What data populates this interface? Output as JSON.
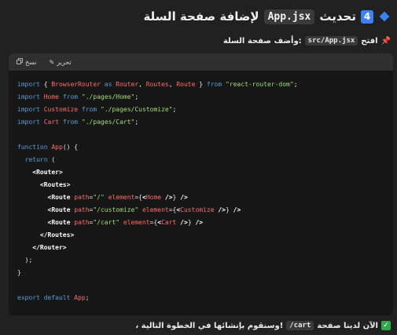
{
  "heading": {
    "badge": "4",
    "word_update": "تحديث",
    "file_code": "App.jsx",
    "rest": "لإضافة صفحة السلة"
  },
  "instruction": {
    "word_open": "افتح",
    "file_code": "src/App.jsx",
    "rest": "وأضف صفحة السلة:"
  },
  "code_header": {
    "copy_label": "نسخ",
    "edit_label": "تحرير"
  },
  "code_lines": [
    [
      [
        "kw",
        "import"
      ],
      [
        "plain",
        " { "
      ],
      [
        "ident",
        "BrowserRouter"
      ],
      [
        "kw",
        " as "
      ],
      [
        "ident",
        "Router"
      ],
      [
        "plain",
        ", "
      ],
      [
        "ident",
        "Routes"
      ],
      [
        "plain",
        ", "
      ],
      [
        "ident",
        "Route"
      ],
      [
        "plain",
        " } "
      ],
      [
        "kw",
        "from"
      ],
      [
        "plain",
        " "
      ],
      [
        "str",
        "\"react-router-dom\""
      ],
      [
        "plain",
        ";"
      ]
    ],
    [
      [
        "kw",
        "import"
      ],
      [
        "plain",
        " "
      ],
      [
        "ident",
        "Home"
      ],
      [
        "kw",
        " from"
      ],
      [
        "plain",
        " "
      ],
      [
        "str",
        "\"./pages/Home\""
      ],
      [
        "plain",
        ";"
      ]
    ],
    [
      [
        "kw",
        "import"
      ],
      [
        "plain",
        " "
      ],
      [
        "ident",
        "Customize"
      ],
      [
        "kw",
        " from"
      ],
      [
        "plain",
        " "
      ],
      [
        "str",
        "\"./pages/Customize\""
      ],
      [
        "plain",
        ";"
      ]
    ],
    [
      [
        "kw",
        "import"
      ],
      [
        "plain",
        " "
      ],
      [
        "ident",
        "Cart"
      ],
      [
        "kw",
        " from"
      ],
      [
        "plain",
        " "
      ],
      [
        "str",
        "\"./pages/Cart\""
      ],
      [
        "plain",
        ";"
      ]
    ],
    [],
    [
      [
        "kw",
        "function"
      ],
      [
        "plain",
        " "
      ],
      [
        "ident",
        "App"
      ],
      [
        "plain",
        "() {"
      ]
    ],
    [
      [
        "plain",
        "  "
      ],
      [
        "kw",
        "return"
      ],
      [
        "plain",
        " ("
      ]
    ],
    [
      [
        "plain",
        "    "
      ],
      [
        "tag",
        "<Router>"
      ]
    ],
    [
      [
        "plain",
        "      "
      ],
      [
        "tag",
        "<Routes>"
      ]
    ],
    [
      [
        "plain",
        "        "
      ],
      [
        "tag",
        "<Route"
      ],
      [
        "plain",
        " "
      ],
      [
        "attr",
        "path"
      ],
      [
        "plain",
        "="
      ],
      [
        "str",
        "\"/\""
      ],
      [
        "plain",
        " "
      ],
      [
        "attr",
        "element"
      ],
      [
        "plain",
        "={"
      ],
      [
        "tag",
        "<"
      ],
      [
        "ident",
        "Home"
      ],
      [
        "tag",
        " />"
      ],
      [
        "plain",
        "} "
      ],
      [
        "tag",
        "/>"
      ]
    ],
    [
      [
        "plain",
        "        "
      ],
      [
        "tag",
        "<Route"
      ],
      [
        "plain",
        " "
      ],
      [
        "attr",
        "path"
      ],
      [
        "plain",
        "="
      ],
      [
        "str",
        "\"/customize\""
      ],
      [
        "plain",
        " "
      ],
      [
        "attr",
        "element"
      ],
      [
        "plain",
        "={"
      ],
      [
        "tag",
        "<"
      ],
      [
        "ident",
        "Customize"
      ],
      [
        "tag",
        " />"
      ],
      [
        "plain",
        "} "
      ],
      [
        "tag",
        "/>"
      ]
    ],
    [
      [
        "plain",
        "        "
      ],
      [
        "tag",
        "<Route"
      ],
      [
        "plain",
        " "
      ],
      [
        "attr",
        "path"
      ],
      [
        "plain",
        "="
      ],
      [
        "str",
        "\"/cart\""
      ],
      [
        "plain",
        " "
      ],
      [
        "attr",
        "element"
      ],
      [
        "plain",
        "={"
      ],
      [
        "tag",
        "<"
      ],
      [
        "ident",
        "Cart"
      ],
      [
        "tag",
        " />"
      ],
      [
        "plain",
        "} "
      ],
      [
        "tag",
        "/>"
      ]
    ],
    [
      [
        "plain",
        "      "
      ],
      [
        "tag",
        "</Routes>"
      ]
    ],
    [
      [
        "plain",
        "    "
      ],
      [
        "tag",
        "</Router>"
      ]
    ],
    [
      [
        "plain",
        "  );"
      ]
    ],
    [
      [
        "plain",
        "}"
      ]
    ],
    [],
    [
      [
        "kw",
        "export"
      ],
      [
        "plain",
        " "
      ],
      [
        "kw",
        "default"
      ],
      [
        "plain",
        " "
      ],
      [
        "ident",
        "App"
      ],
      [
        "plain",
        ";"
      ]
    ]
  ],
  "footer": {
    "check": "✓",
    "text_start": "الآن لدينا صفحة",
    "path_code": "/cart",
    "text_end": "، وسنقوم بإنشائها في الخطوة التالية!"
  },
  "colors": {
    "accent": "#3b82f6",
    "keyword": "#569cd6",
    "identifier": "#ff6b6b",
    "string": "#a3d977"
  }
}
